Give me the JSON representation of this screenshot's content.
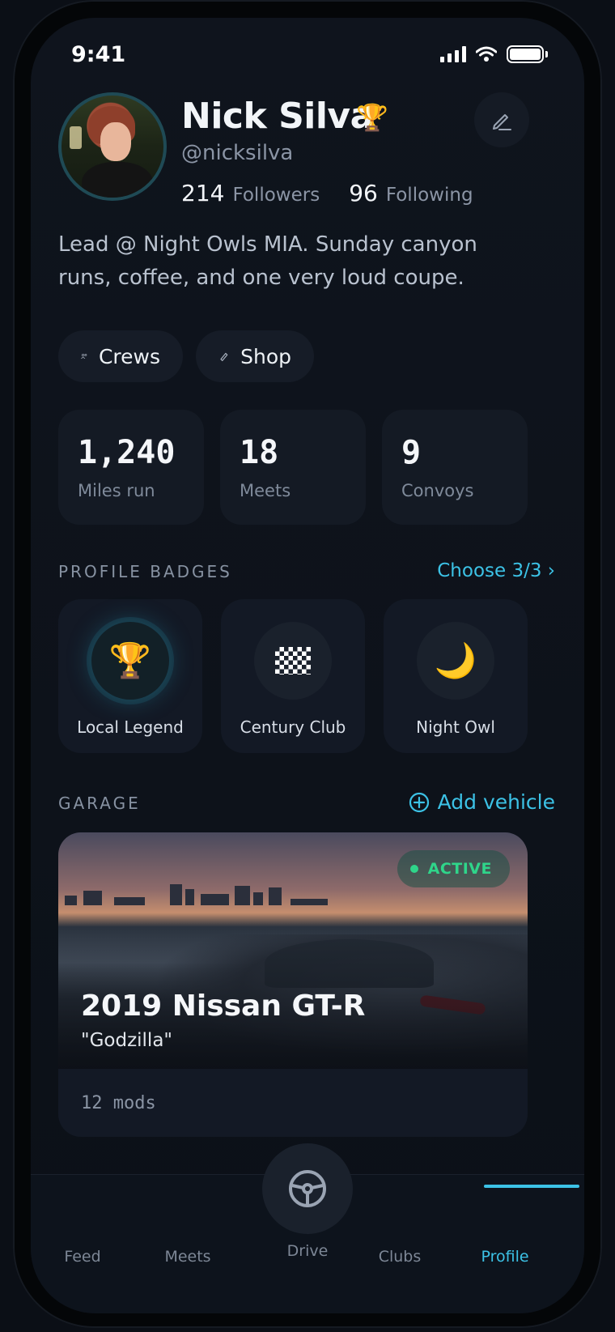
{
  "status_bar": {
    "time": "9:41"
  },
  "profile": {
    "name": "Nick Silva",
    "handle": "@nicksilva",
    "followers_count": "214",
    "followers_label": "Followers",
    "following_count": "96",
    "following_label": "Following",
    "bio": "Lead @ Night Owls MIA. Sunday canyon runs, coffee, and one very loud coupe."
  },
  "actions": {
    "crews_label": "Crews",
    "shop_label": "Shop"
  },
  "stats": [
    {
      "value": "1,240",
      "label": "Miles run"
    },
    {
      "value": "18",
      "label": "Meets"
    },
    {
      "value": "9",
      "label": "Convoys"
    }
  ],
  "badges_section": {
    "title": "PROFILE BADGES",
    "link": "Choose 3/3 ›",
    "items": [
      {
        "label": "Local Legend",
        "icon": "trophy-icon"
      },
      {
        "label": "Century Club",
        "icon": "checkered-flag-icon"
      },
      {
        "label": "Night Owl",
        "icon": "crescent-moon-icon"
      }
    ]
  },
  "garage": {
    "title": "GARAGE",
    "add_label": "Add vehicle",
    "vehicle": {
      "status": "ACTIVE",
      "title": "2019 Nissan GT-R",
      "nickname": "\"Godzilla\"",
      "mods": "12 mods"
    }
  },
  "tabbar": {
    "feed": "Feed",
    "meets": "Meets",
    "drive": "Drive",
    "clubs": "Clubs",
    "profile": "Profile",
    "active": "Profile"
  },
  "colors": {
    "accent": "#3cc2e6",
    "active_status": "#2fd58a",
    "background": "#0f141d",
    "card": "#141a24"
  }
}
